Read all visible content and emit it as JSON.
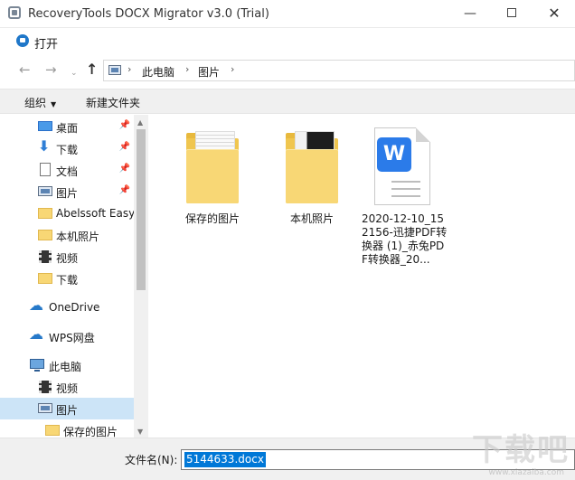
{
  "window": {
    "title": "RecoveryTools DOCX Migrator v3.0 (Trial)",
    "min_label": "—",
    "close_label": "✕"
  },
  "dialog": {
    "title": "打开"
  },
  "nav": {
    "back_icon": "←",
    "forward_icon": "→",
    "recent_icon": "⌄",
    "up_icon": "↑",
    "address": [
      "此电脑",
      "图片"
    ],
    "separator": "›"
  },
  "toolbar": {
    "organize_label": "组织",
    "organize_caret": "▼",
    "new_folder_label": "新建文件夹"
  },
  "sidebar": {
    "pin_icon": "📌",
    "items": [
      {
        "label": "桌面",
        "icon": "desktop-icon",
        "pinned": true
      },
      {
        "label": "下载",
        "icon": "download-arrow-icon",
        "pinned": true
      },
      {
        "label": "文档",
        "icon": "document-icon",
        "pinned": true
      },
      {
        "label": "图片",
        "icon": "pictures-icon",
        "pinned": true
      },
      {
        "label": "Abelssoft Easy",
        "icon": "folder-icon",
        "pinned": false
      },
      {
        "label": "本机照片",
        "icon": "folder-icon",
        "pinned": false
      },
      {
        "label": "视频",
        "icon": "video-icon",
        "pinned": false
      },
      {
        "label": "下载",
        "icon": "folder-icon",
        "pinned": false
      },
      {
        "label": "OneDrive",
        "icon": "cloud-icon",
        "pinned": false
      },
      {
        "label": "WPS网盘",
        "icon": "cloud-icon",
        "pinned": false
      },
      {
        "label": "此电脑",
        "icon": "computer-icon",
        "pinned": false
      },
      {
        "label": "视频",
        "icon": "video-icon",
        "pinned": false
      },
      {
        "label": "图片",
        "icon": "pictures-icon",
        "pinned": false,
        "selected": true
      },
      {
        "label": "保存的图片",
        "icon": "folder-icon",
        "pinned": false
      }
    ],
    "scroll_up": "▲",
    "scroll_down": "▼"
  },
  "files": [
    {
      "name": "保存的图片",
      "type": "folder"
    },
    {
      "name": "本机照片",
      "type": "folder"
    },
    {
      "name": "2020-12-10_152156-迅捷PDF转换器 (1)_赤兔PDF转换器_20...",
      "type": "docx",
      "badge": "W"
    }
  ],
  "filename_bar": {
    "label": "文件名(N):",
    "value": "5144633.docx"
  },
  "watermark": {
    "text": "下载吧",
    "sub": "www.xiazaiba.com"
  }
}
